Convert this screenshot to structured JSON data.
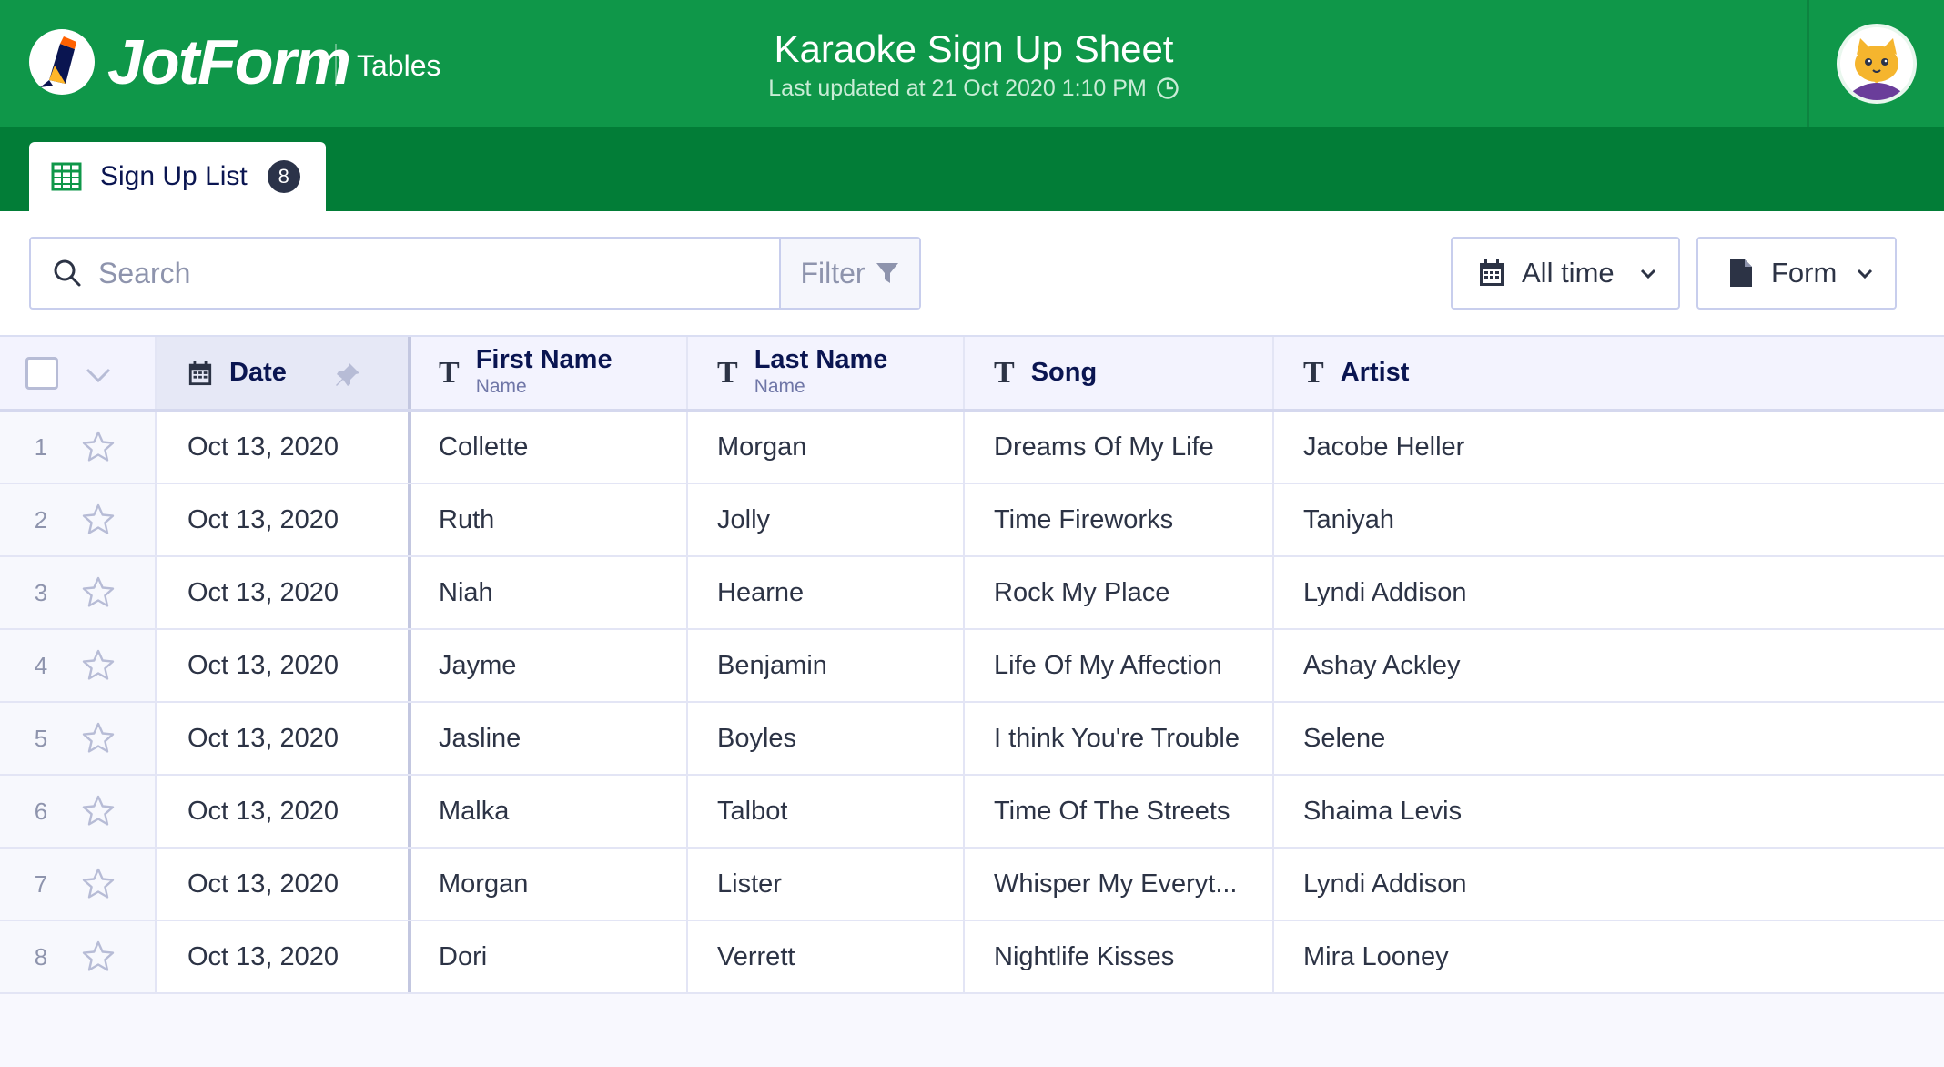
{
  "header": {
    "logo_text": "JotForm",
    "product": "Tables",
    "title": "Karaoke Sign Up Sheet",
    "subtitle": "Last updated at 21 Oct 2020 1:10 PM"
  },
  "tab": {
    "label": "Sign Up List",
    "count": "8"
  },
  "toolbar": {
    "search_placeholder": "Search",
    "filter_label": "Filter",
    "time_label": "All time",
    "form_label": "Form"
  },
  "columns": {
    "date": "Date",
    "first": {
      "label": "First Name",
      "sub": "Name"
    },
    "last": {
      "label": "Last Name",
      "sub": "Name"
    },
    "song": "Song",
    "artist": "Artist"
  },
  "rows": [
    {
      "num": "1",
      "date": "Oct 13, 2020",
      "first": "Collette",
      "last": "Morgan",
      "song": "Dreams Of My Life",
      "artist": "Jacobe Heller"
    },
    {
      "num": "2",
      "date": "Oct 13, 2020",
      "first": "Ruth",
      "last": "Jolly",
      "song": "Time Fireworks",
      "artist": "Taniyah"
    },
    {
      "num": "3",
      "date": "Oct 13, 2020",
      "first": "Niah",
      "last": "Hearne",
      "song": "Rock My Place",
      "artist": "Lyndi Addison"
    },
    {
      "num": "4",
      "date": "Oct 13, 2020",
      "first": "Jayme",
      "last": "Benjamin",
      "song": "Life Of My Affection",
      "artist": "Ashay Ackley"
    },
    {
      "num": "5",
      "date": "Oct 13, 2020",
      "first": "Jasline",
      "last": "Boyles",
      "song": "I think You're Trouble",
      "artist": "Selene"
    },
    {
      "num": "6",
      "date": "Oct 13, 2020",
      "first": "Malka",
      "last": "Talbot",
      "song": "Time Of The Streets",
      "artist": "Shaima Levis"
    },
    {
      "num": "7",
      "date": "Oct 13, 2020",
      "first": "Morgan",
      "last": "Lister",
      "song": "Whisper My Everyt...",
      "artist": "Lyndi Addison"
    },
    {
      "num": "8",
      "date": "Oct 13, 2020",
      "first": "Dori",
      "last": "Verrett",
      "song": "Nightlife Kisses",
      "artist": "Mira Looney"
    }
  ],
  "colors": {
    "header_green": "#0f9749",
    "tabbar_green": "#027d37",
    "navy": "#0a1551"
  },
  "icons": [
    "jotform-logo-icon",
    "clock-icon",
    "avatar-cat-icon",
    "table-grid-icon",
    "search-icon",
    "filter-funnel-icon",
    "calendar-icon",
    "document-icon",
    "chevron-down-icon",
    "text-type-icon",
    "pin-icon",
    "star-icon"
  ]
}
